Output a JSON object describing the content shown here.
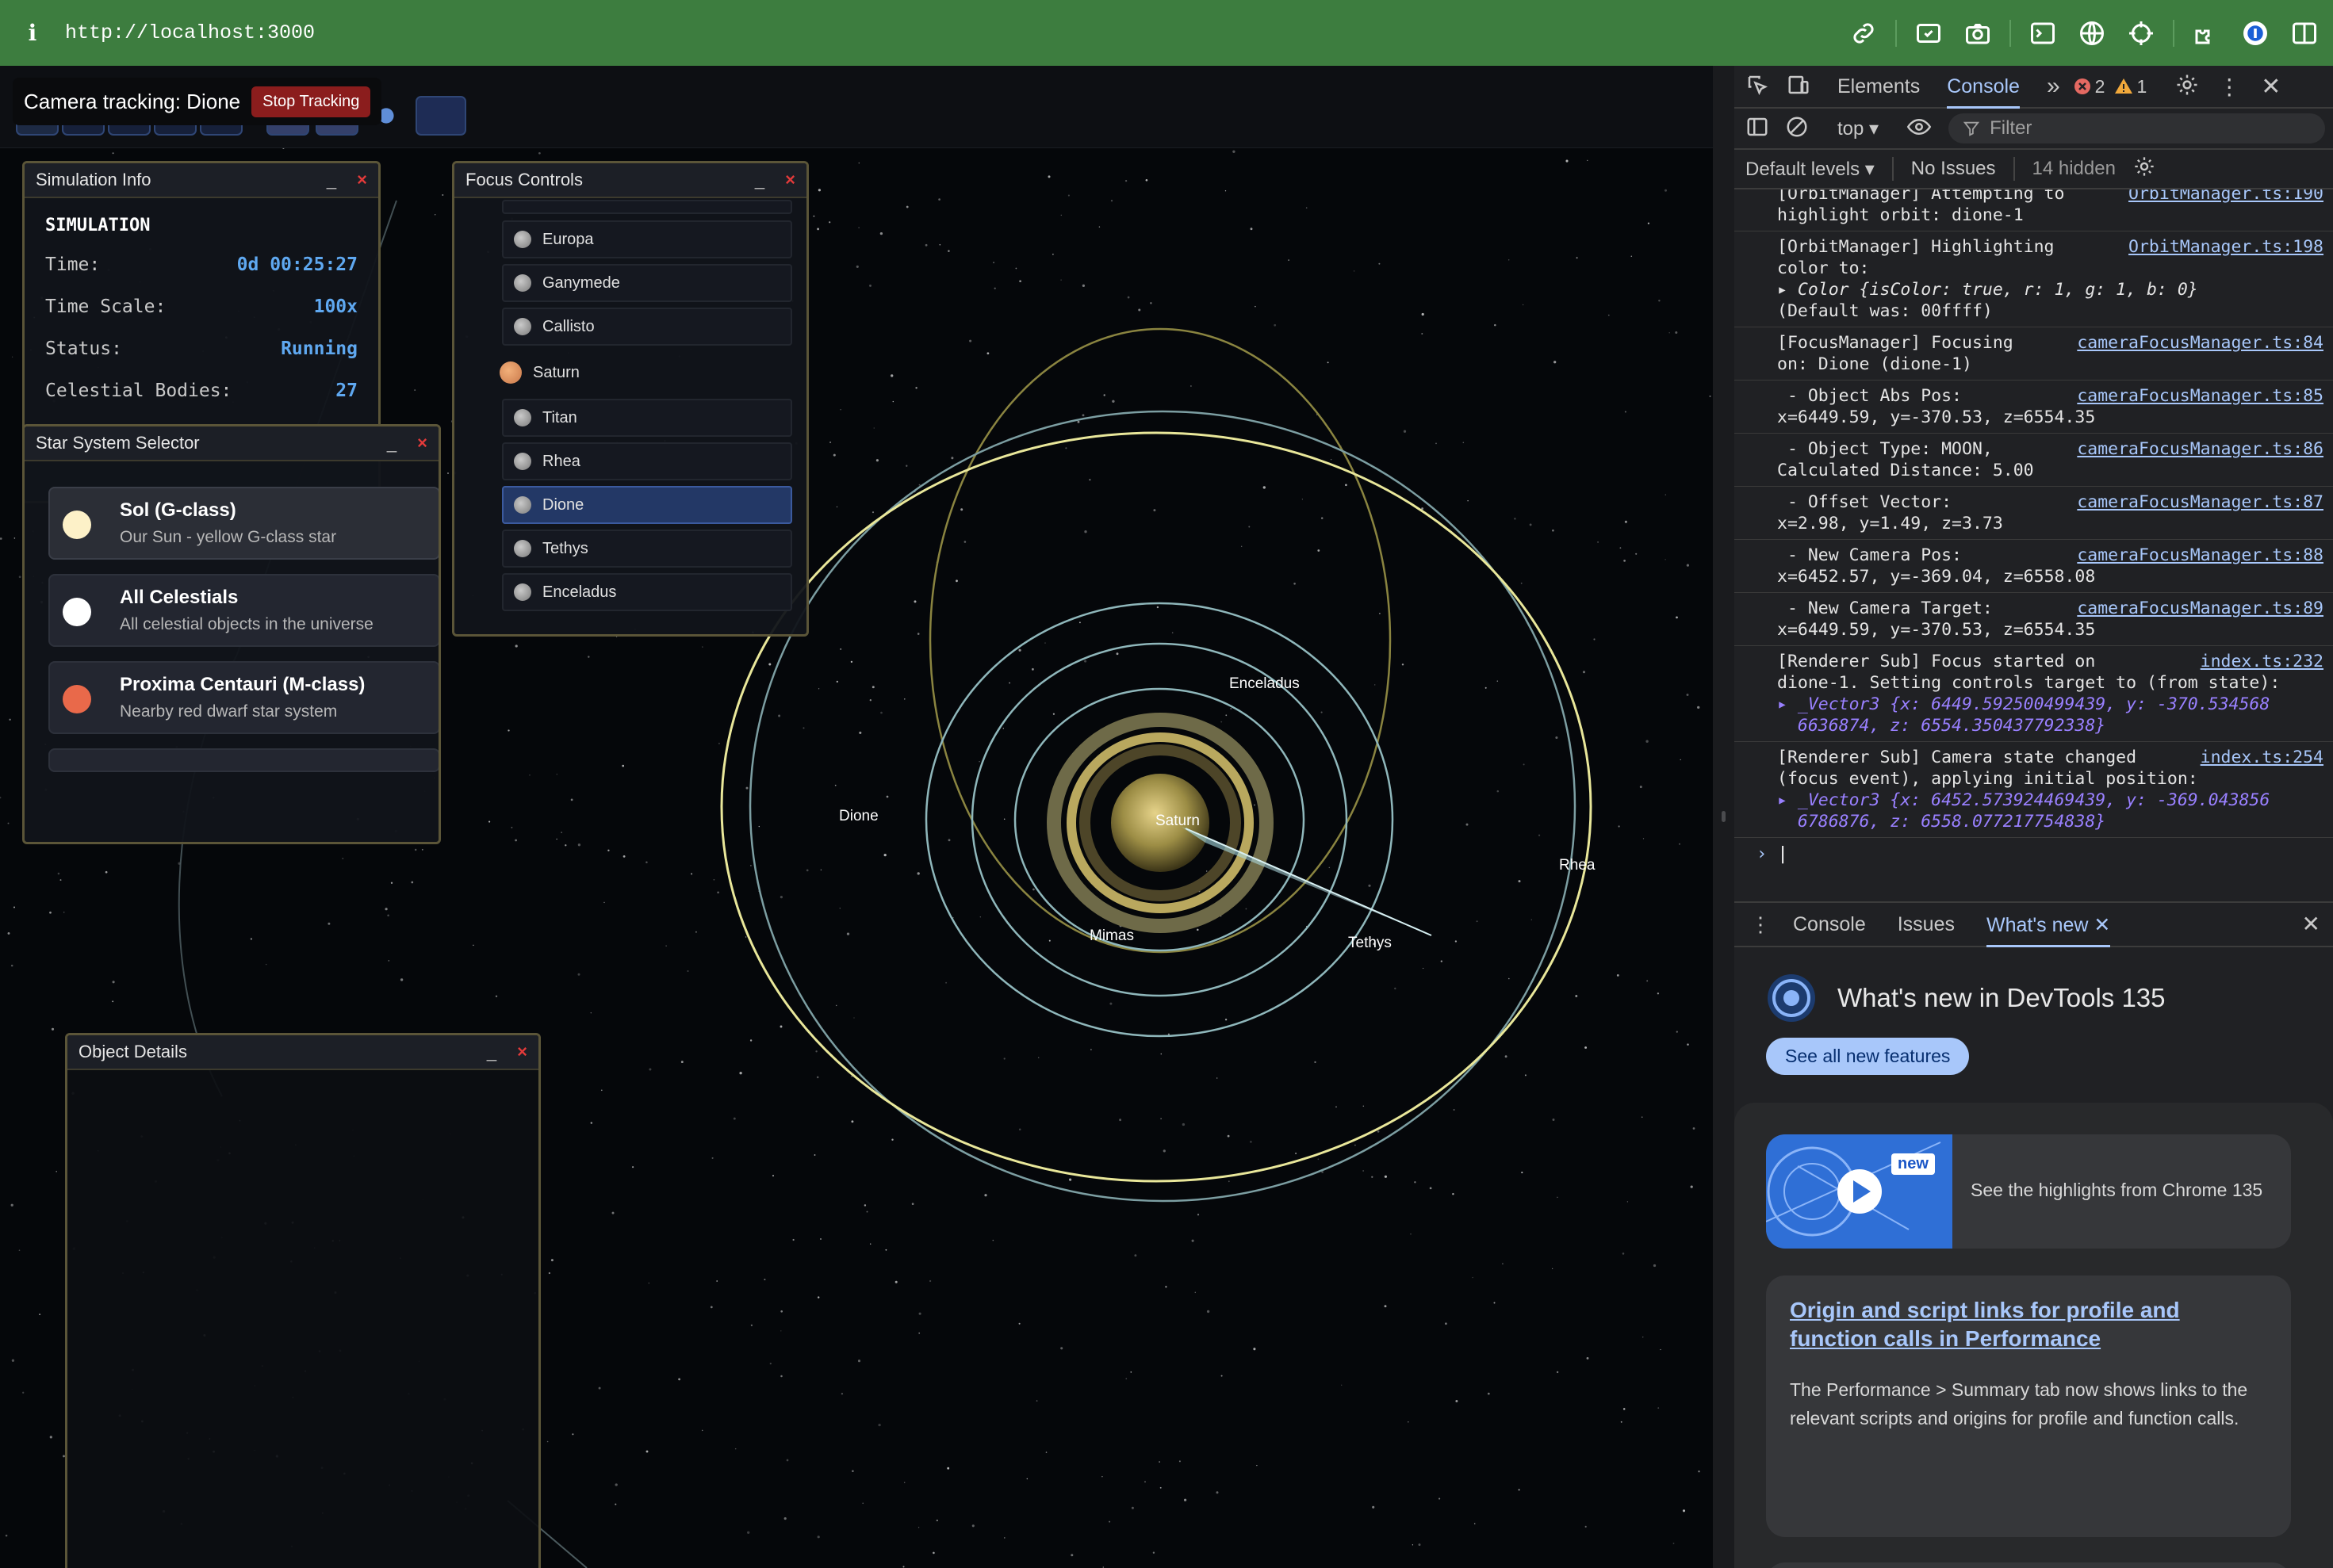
{
  "browser": {
    "url": "http://localhost:3000",
    "info_glyph": "i"
  },
  "tracking": {
    "label": "Camera tracking: Dione",
    "stop_label": "Stop Tracking"
  },
  "sim_info": {
    "title": "Simulation Info",
    "heading": "SIMULATION",
    "rows": [
      {
        "label": "Time:",
        "value": "0d 00:25:27"
      },
      {
        "label": "Time Scale:",
        "value": "100x"
      },
      {
        "label": "Status:",
        "value": "Running"
      },
      {
        "label": "Celestial Bodies:",
        "value": "27"
      }
    ]
  },
  "star_selector": {
    "title": "Star System Selector",
    "items": [
      {
        "name": "Sol (G-class)",
        "desc": "Our Sun - yellow G-class star",
        "color": "#fdf1c8"
      },
      {
        "name": "All Celestials",
        "desc": "All celestial objects in the universe",
        "color": "#ffffff"
      },
      {
        "name": "Proxima Centauri (M-class)",
        "desc": "Nearby red dwarf star system",
        "color": "#e9694a"
      }
    ]
  },
  "focus": {
    "title": "Focus Controls",
    "items": [
      {
        "label": "Europa"
      },
      {
        "label": "Ganymede"
      },
      {
        "label": "Callisto"
      },
      {
        "label": "Saturn"
      },
      {
        "label": "Titan"
      },
      {
        "label": "Rhea"
      },
      {
        "label": "Dione"
      },
      {
        "label": "Tethys"
      },
      {
        "label": "Enceladus"
      }
    ]
  },
  "details": {
    "title": "Object Details"
  },
  "panel_controls": {
    "minimize": "_",
    "close": "×"
  },
  "scene_labels": {
    "saturn": "Saturn",
    "enceladus": "Enceladus",
    "dione": "Dione",
    "rhea": "Rhea",
    "mimas": "Mimas",
    "tethys": "Tethys"
  },
  "devtools": {
    "tabs": {
      "elements": "Elements",
      "console": "Console",
      "more": "»"
    },
    "errors": "2",
    "warnings": "1",
    "context": "top",
    "filter_placeholder": "Filter",
    "levels": "Default levels",
    "issues": "No Issues",
    "hidden": "14 hidden",
    "logs": [
      {
        "text": "[OrbitManager] Attempting to\nhighlight orbit: dione-1",
        "src": "OrbitManager.ts:190"
      },
      {
        "text": "[OrbitManager] Highlighting\ncolor to:",
        "src": "OrbitManager.ts:198",
        "obj": "▸ Color {isColor: true, r: 1, g: 1, b: 0}",
        "tail": "(Default was: 00ffff)"
      },
      {
        "text": "[FocusManager] Focusing\non: Dione (dione-1)",
        "src": "cameraFocusManager.ts:84"
      },
      {
        "text": " - Object Abs Pos:\nx=6449.59, y=-370.53, z=6554.35",
        "src": "cameraFocusManager.ts:85"
      },
      {
        "text": " - Object Type: MOON,\nCalculated Distance: 5.00",
        "src": "cameraFocusManager.ts:86"
      },
      {
        "text": " - Offset Vector:\nx=2.98, y=1.49, z=3.73",
        "src": "cameraFocusManager.ts:87"
      },
      {
        "text": " - New Camera Pos:\nx=6452.57, y=-369.04, z=6558.08",
        "src": "cameraFocusManager.ts:88"
      },
      {
        "text": " - New Camera Target:\nx=6449.59, y=-370.53, z=6554.35",
        "src": "cameraFocusManager.ts:89"
      },
      {
        "text": "[Renderer Sub] Focus started on\ndione-1. Setting controls target to (from state):",
        "src": "index.ts:232",
        "obj": "▸ _Vector3 {x: 6449.592500499439, y: -370.534568\n  6636874, z: 6554.350437792338}"
      },
      {
        "text": "[Renderer Sub] Camera state changed\n(focus event), applying initial position:",
        "src": "index.ts:254",
        "obj": "▸ _Vector3 {x: 6452.573924469439, y: -369.043856\n  6786876, z: 6558.077217754838}"
      }
    ],
    "prompt": "›",
    "drawer_tabs": {
      "console": "Console",
      "issues": "Issues",
      "whats_new": "What's new"
    },
    "whats_new_title": "What's new in DevTools 135",
    "see_all": "See all new features",
    "card1_badge": "new",
    "card1_text": "See the highlights from Chrome 135",
    "card2_title": "Origin and script links for profile and function calls in Performance",
    "card2_text": "The Performance > Summary tab now shows links to the relevant scripts and origins for profile and function calls."
  }
}
